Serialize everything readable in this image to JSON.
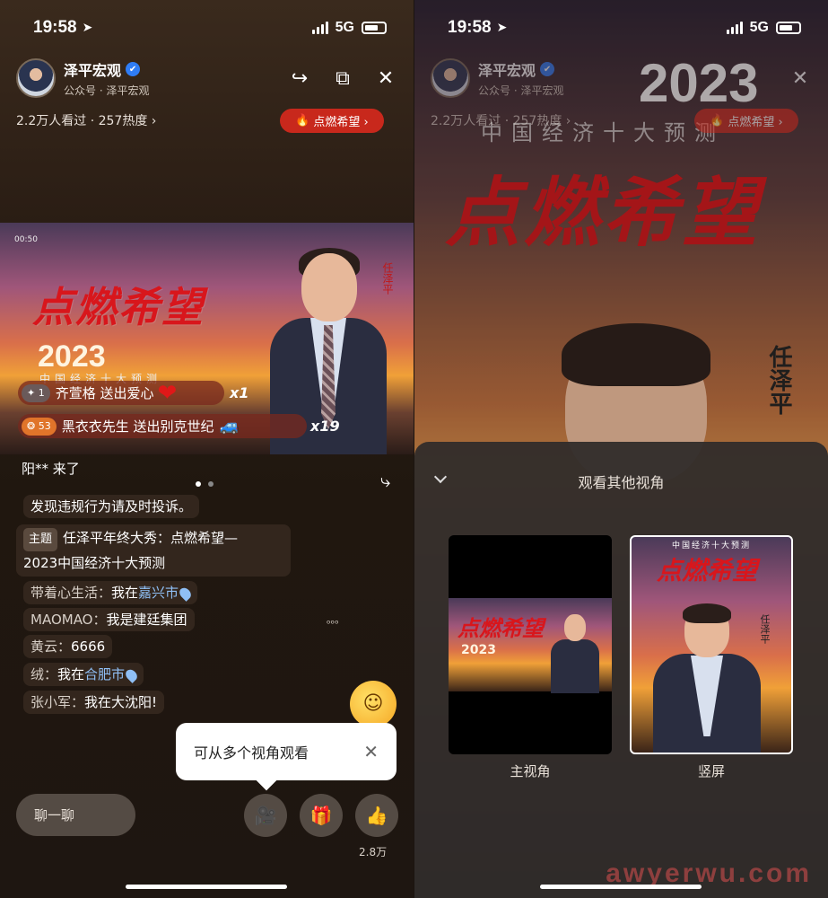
{
  "status": {
    "time": "19:58",
    "network": "5G"
  },
  "header": {
    "name": "泽平宏观",
    "subtitle": "公众号 · 泽平宏观",
    "stats": "2.2万人看过 · 257热度 ›",
    "fire_label": "点燃希望 ›"
  },
  "video": {
    "elapsed": "00:50",
    "title": "点燃希望",
    "year": "2023",
    "subtitle": "中国经济十大预测",
    "speaker": "任泽平"
  },
  "gifts": [
    {
      "level": "✦ 1",
      "text": "齐萱格 送出爱心",
      "icon": "❤",
      "count": "x1"
    },
    {
      "level": "❂ 53",
      "text": "黑衣衣先生 送出别克世纪",
      "icon": "🚙",
      "count": "x19"
    }
  ],
  "chat": [
    {
      "who": "",
      "msg": "阳** 来了"
    },
    {
      "who": "",
      "msg": "发现违规行为请及时投诉。"
    },
    {
      "tag": "主题",
      "msg": "任泽平年终大秀：点燃希望—",
      "msg2": "2023中国经济十大预测"
    },
    {
      "who": "带着心生活：",
      "msg": "我在",
      "loc": "嘉兴市"
    },
    {
      "who": "MAOMAO：",
      "msg": "我是建廷集团"
    },
    {
      "who": "黄云：",
      "msg": "6666"
    },
    {
      "who": "绒：",
      "msg": "我在",
      "loc": "合肥市"
    },
    {
      "who": "张小军：",
      "msg": "我在大沈阳!"
    }
  ],
  "tooltip": "可从多个视角观看",
  "bottom": {
    "chat_placeholder": "聊一聊",
    "like_count": "2.8万"
  },
  "sheet": {
    "title": "观看其他视角",
    "options": [
      {
        "label": "主视角"
      },
      {
        "label": "竖屏"
      }
    ]
  },
  "background_text": {
    "year": "2023",
    "subtitle": "中国经济十大预测",
    "title": "点燃希望",
    "name": "任泽平"
  },
  "watermark": "awyerwu.com",
  "colors": {
    "accent_red": "#c8281c",
    "verified_blue": "#2f7df6",
    "location_blue": "#8fbff5"
  }
}
